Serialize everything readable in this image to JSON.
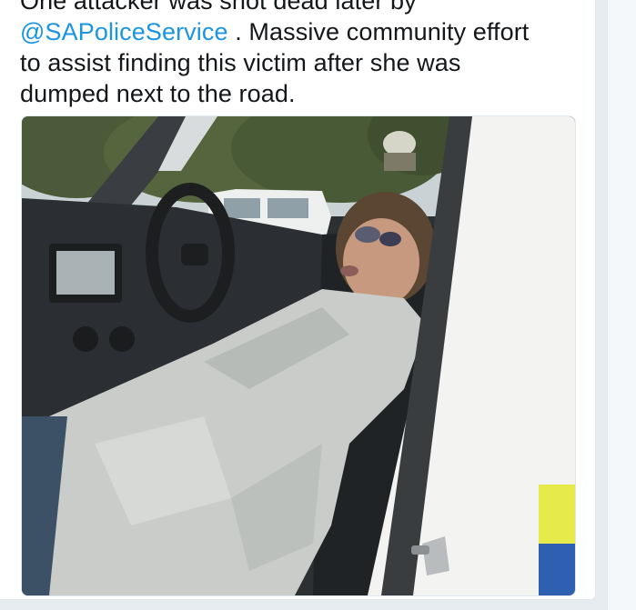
{
  "tweet": {
    "line1": "One attacker was shot dead later by",
    "mention": "@SAPoliceService",
    "line2_rest": " . Massive community effort",
    "line3": "to assist finding this victim after she was",
    "line4": "dumped next to the road."
  },
  "media": {
    "alt": "photo",
    "colors": {
      "sky": "#c9d3d6",
      "trees": "#4b5b3a",
      "dashboard": "#2b2f33",
      "jacket": "#c9ccc8",
      "door": "#f3f4f2",
      "reflective_yellow": "#e6ea4b",
      "reflective_blue": "#2f5fb0"
    }
  }
}
